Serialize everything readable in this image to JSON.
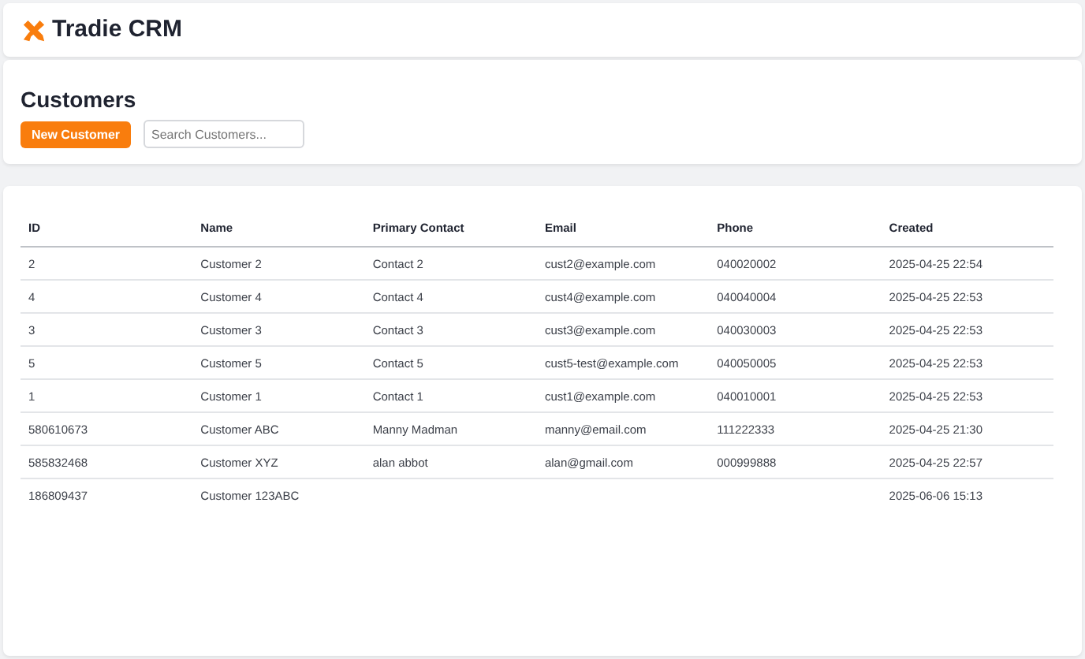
{
  "app": {
    "title": "Tradie CRM"
  },
  "page": {
    "heading": "Customers",
    "new_button": "New Customer",
    "search": {
      "placeholder": "Search Customers..."
    }
  },
  "table": {
    "columns": [
      "ID",
      "Name",
      "Primary Contact",
      "Email",
      "Phone",
      "Created"
    ],
    "rows": [
      [
        "2",
        "Customer 2",
        "Contact 2",
        "cust2@example.com",
        "040020002",
        "2025-04-25 22:54"
      ],
      [
        "4",
        "Customer 4",
        "Contact 4",
        "cust4@example.com",
        "040040004",
        "2025-04-25 22:53"
      ],
      [
        "3",
        "Customer 3",
        "Contact 3",
        "cust3@example.com",
        "040030003",
        "2025-04-25 22:53"
      ],
      [
        "5",
        "Customer 5",
        "Contact 5",
        "cust5-test@example.com",
        "040050005",
        "2025-04-25 22:53"
      ],
      [
        "1",
        "Customer 1",
        "Contact 1",
        "cust1@example.com",
        "040010001",
        "2025-04-25 22:53"
      ],
      [
        "580610673",
        "Customer ABC",
        "Manny Madman",
        "manny@email.com",
        "111222333",
        "2025-04-25 21:30"
      ],
      [
        "585832468",
        "Customer XYZ",
        "alan abbot",
        "alan@gmail.com",
        "000999888",
        "2025-04-25 22:57"
      ],
      [
        "186809437",
        "Customer 123ABC",
        null,
        null,
        null,
        "2025-06-06 15:13"
      ]
    ]
  }
}
